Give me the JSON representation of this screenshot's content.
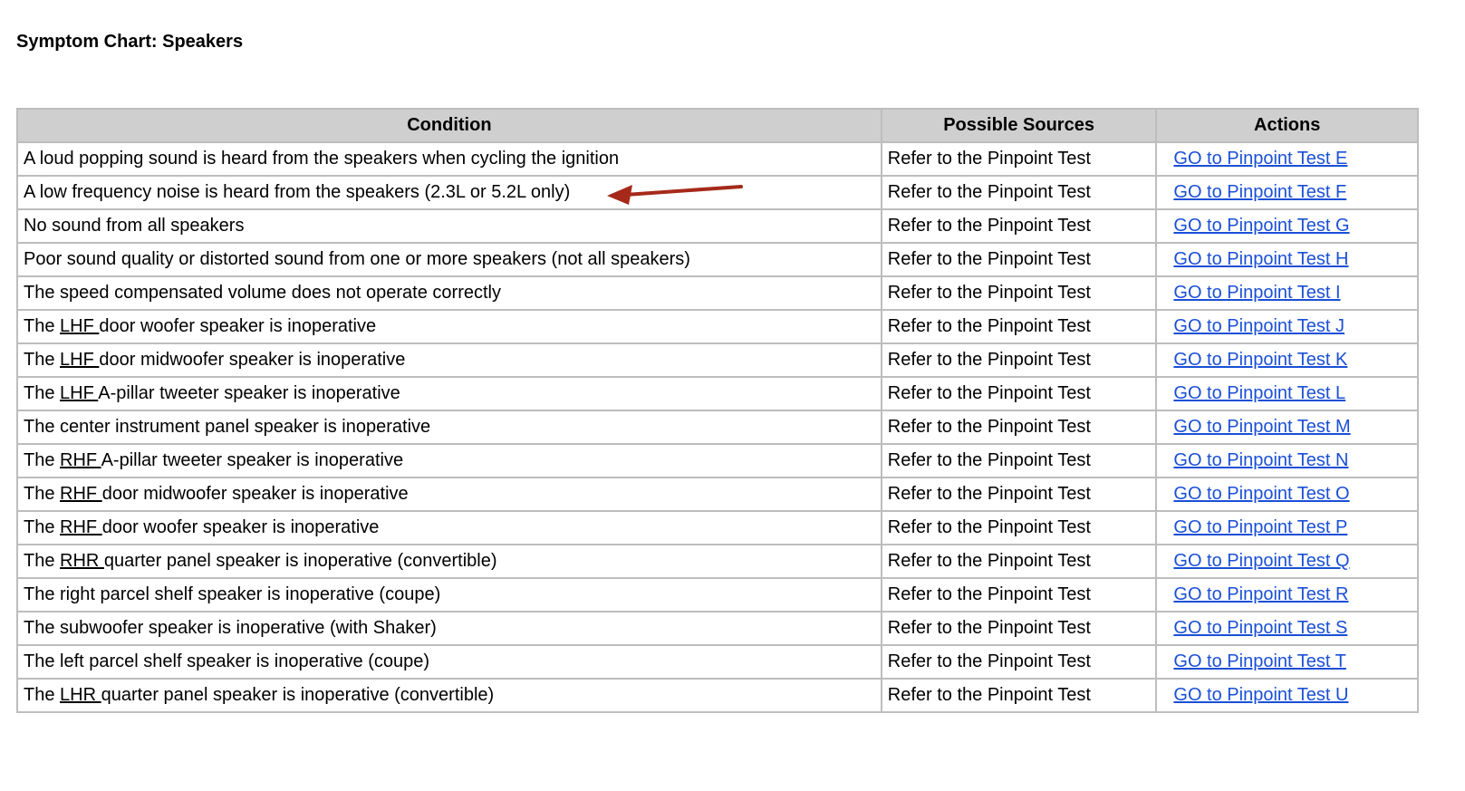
{
  "page_title": "Symptom Chart: Speakers",
  "table": {
    "headers": {
      "condition": "Condition",
      "sources": "Possible Sources",
      "actions": "Actions"
    },
    "rows": [
      {
        "pre": "A loud popping sound is heard from the speakers when cycling the ignition",
        "abbr": "",
        "post": "",
        "source": "Refer to the Pinpoint Test",
        "action": "GO to Pinpoint Test E"
      },
      {
        "pre": "A low frequency noise is heard from the speakers (2.3L or 5.2L only)",
        "abbr": "",
        "post": "",
        "source": "Refer to the Pinpoint Test",
        "action": "GO to Pinpoint Test F"
      },
      {
        "pre": "No sound from all speakers",
        "abbr": "",
        "post": "",
        "source": "Refer to the Pinpoint Test",
        "action": "GO to Pinpoint Test G"
      },
      {
        "pre": "Poor sound quality or distorted sound from one or more speakers (not all speakers)",
        "abbr": "",
        "post": "",
        "source": "Refer to the Pinpoint Test",
        "action": "GO to Pinpoint Test H"
      },
      {
        "pre": "The speed compensated volume does not operate correctly",
        "abbr": "",
        "post": "",
        "source": "Refer to the Pinpoint Test",
        "action": "GO to Pinpoint Test I"
      },
      {
        "pre": "The ",
        "abbr": "LHF ",
        "post": "door woofer speaker is inoperative",
        "source": "Refer to the Pinpoint Test",
        "action": "GO to Pinpoint Test J"
      },
      {
        "pre": "The ",
        "abbr": "LHF ",
        "post": "door midwoofer speaker is inoperative",
        "source": "Refer to the Pinpoint Test",
        "action": "GO to Pinpoint Test K"
      },
      {
        "pre": "The ",
        "abbr": "LHF ",
        "post": "A-pillar tweeter speaker is inoperative",
        "source": "Refer to the Pinpoint Test",
        "action": "GO to Pinpoint Test L"
      },
      {
        "pre": "The center instrument panel speaker is inoperative",
        "abbr": "",
        "post": "",
        "source": "Refer to the Pinpoint Test",
        "action": "GO to Pinpoint Test M"
      },
      {
        "pre": "The ",
        "abbr": "RHF ",
        "post": "A-pillar tweeter speaker is inoperative",
        "source": "Refer to the Pinpoint Test",
        "action": "GO to Pinpoint Test N"
      },
      {
        "pre": "The ",
        "abbr": "RHF ",
        "post": "door midwoofer speaker is inoperative",
        "source": "Refer to the Pinpoint Test",
        "action": "GO to Pinpoint Test O"
      },
      {
        "pre": "The ",
        "abbr": "RHF ",
        "post": "door woofer speaker is inoperative",
        "source": "Refer to the Pinpoint Test",
        "action": "GO to Pinpoint Test P"
      },
      {
        "pre": "The ",
        "abbr": "RHR ",
        "post": "quarter panel speaker is inoperative (convertible)",
        "source": "Refer to the Pinpoint Test",
        "action": "GO to Pinpoint Test Q"
      },
      {
        "pre": "The right parcel shelf speaker is inoperative (coupe)",
        "abbr": "",
        "post": "",
        "source": "Refer to the Pinpoint Test",
        "action": "GO to Pinpoint Test R"
      },
      {
        "pre": "The subwoofer speaker is inoperative (with Shaker)",
        "abbr": "",
        "post": "",
        "source": "Refer to the Pinpoint Test",
        "action": "GO to Pinpoint Test S"
      },
      {
        "pre": "The left parcel shelf speaker is inoperative (coupe)",
        "abbr": "",
        "post": "",
        "source": "Refer to the Pinpoint Test",
        "action": "GO to Pinpoint Test T"
      },
      {
        "pre": "The ",
        "abbr": "LHR ",
        "post": "quarter panel speaker is inoperative (convertible)",
        "source": "Refer to the Pinpoint Test",
        "action": "GO to Pinpoint Test U"
      }
    ]
  },
  "colors": {
    "link": "#1a4fd6",
    "header_bg": "#cfcfcf",
    "grid": "#bdbdbd",
    "arrow": "#a52a1a"
  },
  "annotation": {
    "icon": "red-arrow-icon"
  }
}
